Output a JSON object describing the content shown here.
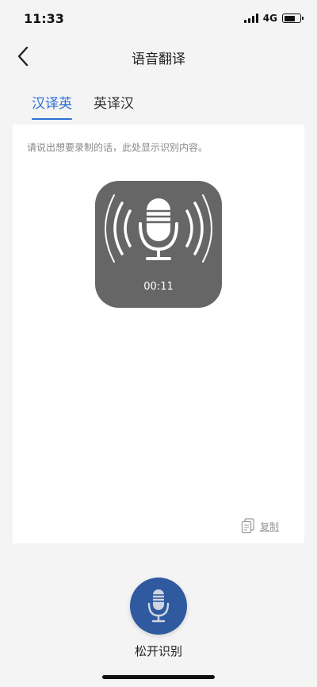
{
  "status_bar": {
    "time": "11:33",
    "network": "4G",
    "battery_level": 0.7
  },
  "nav": {
    "back_icon": "chevron-left-icon",
    "title": "语音翻译"
  },
  "tabs": [
    {
      "label": "汉译英",
      "active": true
    },
    {
      "label": "英译汉",
      "active": false
    }
  ],
  "content": {
    "hint": "请说出想要录制的话，此处显示识别内容。",
    "copy_label": "复制",
    "copy_icon": "copy-icon"
  },
  "recording": {
    "timer": "00:11",
    "icon": "microphone-icon"
  },
  "record_button": {
    "label": "松开识别",
    "icon": "microphone-icon"
  },
  "colors": {
    "accent": "#2f6fd6",
    "record_button": "#2f5aa0",
    "overlay": "#666666",
    "background": "#f4f4f4"
  }
}
